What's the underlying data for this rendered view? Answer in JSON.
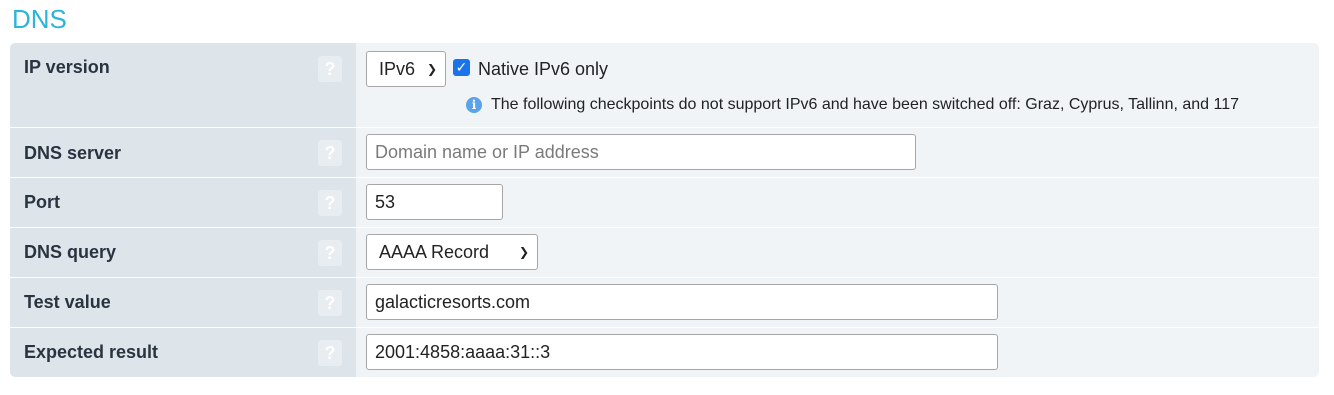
{
  "section": {
    "title": "DNS"
  },
  "help_glyph": "?",
  "rows": {
    "ip_version": {
      "label": "IP version",
      "select_value": "IPv6",
      "checkbox_checked": true,
      "checkbox_label": "Native IPv6 only",
      "info_text": "The following checkpoints do not support IPv6 and have been switched off: Graz, Cyprus, Tallinn, and 117"
    },
    "dns_server": {
      "label": "DNS server",
      "value": "",
      "placeholder": "Domain name or IP address"
    },
    "port": {
      "label": "Port",
      "value": "53"
    },
    "dns_query": {
      "label": "DNS query",
      "select_value": "AAAA Record"
    },
    "test_value": {
      "label": "Test value",
      "value": "galacticresorts.com"
    },
    "expected_result": {
      "label": "Expected result",
      "value": "2001:4858:aaaa:31::3"
    }
  },
  "colors": {
    "title": "#29b6d8",
    "label_bg": "#dde4ea",
    "value_bg": "#f0f4f7",
    "checkbox": "#1a73e8",
    "info_icon": "#5aa3e8"
  }
}
